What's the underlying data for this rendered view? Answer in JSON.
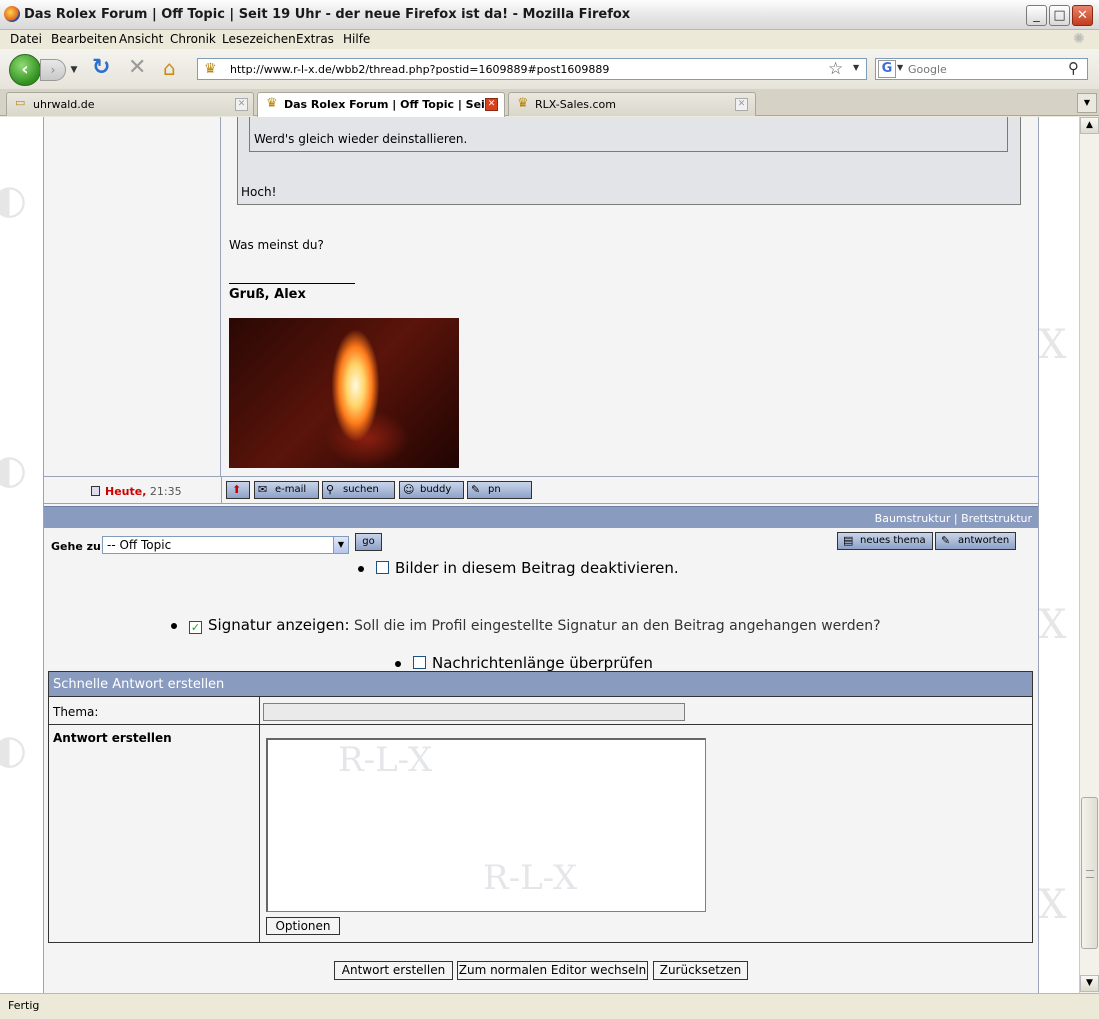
{
  "window": {
    "title": "Das Rolex Forum | Off Topic | Seit 19 Uhr - der neue Firefox ist da! - Mozilla Firefox",
    "minimize": "_",
    "maximize": "□",
    "close": "✕"
  },
  "menu": [
    "Datei",
    "Bearbeiten",
    "Ansicht",
    "Chronik",
    "Lesezeichen",
    "Extras",
    "Hilfe"
  ],
  "nav": {
    "url": "http://www.r-l-x.de/wbb2/thread.php?postid=1609889#post1609889",
    "search_placeholder": "Google",
    "search_engine_letter": "G"
  },
  "tabs": [
    {
      "label": "uhrwald.de",
      "active": false
    },
    {
      "label": "Das Rolex Forum | Off Topic | Sei...",
      "active": true
    },
    {
      "label": "RLX-Sales.com",
      "active": false
    }
  ],
  "post": {
    "quote_inner": "Werd's gleich wieder deinstallieren.",
    "quote_outer": "Hoch!",
    "reply": "Was meinst du?",
    "signature": "Gruß, Alex",
    "date_today": "Heute,",
    "date_time": " 21:35",
    "buttons": {
      "email": "e-mail",
      "search": "suchen",
      "buddy": "buddy",
      "pm": "pn"
    }
  },
  "structure_links": {
    "tree": "Baumstruktur",
    "separator": " | ",
    "board": "Brettstruktur"
  },
  "goto": {
    "label": "Gehe zu:",
    "selected": "-- Off Topic",
    "go": "go"
  },
  "actions": {
    "new_topic": "neues thema",
    "reply": "antworten"
  },
  "options": {
    "disable_images": "Bilder in diesem Beitrag deaktivieren.",
    "show_signature_label": "Signatur anzeigen:",
    "show_signature_desc": " Soll die im Profil eingestellte Signatur an den Beitrag angehangen werden?",
    "check_length": "Nachrichtenlänge überprüfen",
    "show_signature_checked_mark": "✓"
  },
  "quick_reply": {
    "header": "Schnelle Antwort erstellen",
    "subject_label": "Thema:",
    "message_label": "Antwort erstellen",
    "options_button": "Optionen",
    "submit": "Antwort erstellen",
    "switch_editor": "Zum normalen Editor wechseln",
    "reset": "Zurücksetzen"
  },
  "status": "Fertig",
  "watermark": "R-L-X",
  "colors": {
    "forum_blue": "#8a9bc0",
    "today_red": "#cc0000"
  }
}
